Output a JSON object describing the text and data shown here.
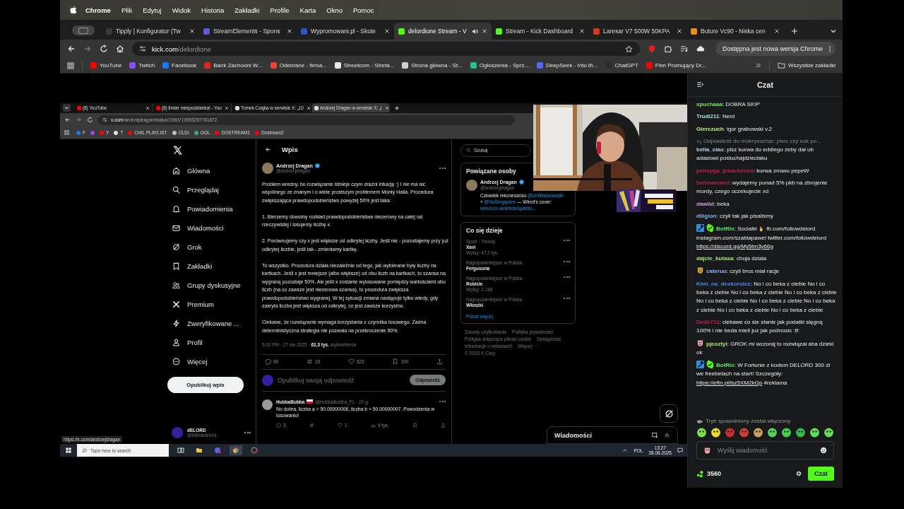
{
  "menu_bar": {
    "app": "Chrome",
    "items": [
      "Plik",
      "Edytuj",
      "Widok",
      "Historia",
      "Zakładki",
      "Profile",
      "Karta",
      "Okno",
      "Pomoc"
    ]
  },
  "tabs": [
    {
      "title": "Tipply | Konfigurator (Tw",
      "color": "#3a3a3a",
      "selected": false,
      "audio": false
    },
    {
      "title": "StreamElements - Spons",
      "color": "#5b5bd6",
      "selected": false,
      "audio": false
    },
    {
      "title": "Wypromowani.pl - Skute",
      "color": "#2f55c4",
      "selected": false,
      "audio": false
    },
    {
      "title": "delordione Stream - V",
      "color": "#53fc18",
      "selected": true,
      "audio": true
    },
    {
      "title": "Stream - Kick Dashboard",
      "color": "#53fc18",
      "selected": false,
      "audio": false
    },
    {
      "title": "Laresar V7 500W 50KPA",
      "color": "#d63a24",
      "selected": false,
      "audio": false
    },
    {
      "title": "Buture Vc90 - Niska cen",
      "color": "#f08c1a",
      "selected": false,
      "audio": false
    }
  ],
  "address": {
    "host": "kick.com",
    "path": "/delordione"
  },
  "update_button": "Dostępna jest nowa wersja Chrome",
  "bookmarks": [
    {
      "title": "YouTube",
      "color": "#ff0000"
    },
    {
      "title": "Twitch",
      "color": "#9146ff"
    },
    {
      "title": "Facebook",
      "color": "#1877f2"
    },
    {
      "title": "Bank Zachodni W...",
      "color": "#e0231b"
    },
    {
      "title": "Odebrane - firma...",
      "color": "#ea4335"
    },
    {
      "title": "Streetcom - Strefa...",
      "color": "#e8e8e8"
    },
    {
      "title": "Strona główna - St...",
      "color": "#cfcfcf"
    },
    {
      "title": "Ogłoszenia - Sprz...",
      "color": "#23c08a"
    },
    {
      "title": "DeepSeek - Into th...",
      "color": "#4d6bfe"
    },
    {
      "title": "ChatGPT",
      "color": "#2b2b2b"
    },
    {
      "title": "Film Promujący Dr...",
      "color": "#ff0000"
    }
  ],
  "all_bookmarks": "Wszystkie zakładki",
  "stream": {
    "tabs": [
      {
        "title": "(8) YouTube",
        "color": "#ff0000",
        "selected": false
      },
      {
        "title": "(8) tinder niespodzianka! - You",
        "color": "#ff0000",
        "selected": false
      },
      {
        "title": "Tomek Czajka w serwisie X: „10",
        "color": "#e0e0e0",
        "selected": false
      },
      {
        "title": "Andrzej Dragan w serwisie X: „I",
        "color": "#e0e0e0",
        "selected": true
      }
    ],
    "address": {
      "host": "x.com",
      "path": "/andrzejdragan/status/1960719555287781872"
    },
    "bookmarks": [
      {
        "title": "F",
        "color": "#1877f2"
      },
      {
        "color": "#9146ff"
      },
      {
        "title": "Y",
        "color": "#ff0000"
      },
      {
        "title": "T",
        "color": "#e0e0e0"
      },
      {
        "title": "CHIL PLAYLIST",
        "color": "#ff0000"
      },
      {
        "title": "OLD\\",
        "color": "#bbbbbb"
      },
      {
        "title": "GOL",
        "color": "#3aa88a"
      },
      {
        "title": "DOSTREAM1",
        "color": "#ff0000"
      },
      {
        "title": "Dostream2",
        "color": "#ff0000"
      }
    ],
    "nav": [
      {
        "label": "Główna",
        "kind": "home"
      },
      {
        "label": "Przeglądaj",
        "kind": "search"
      },
      {
        "label": "Powiadomienia",
        "kind": "bell"
      },
      {
        "label": "Wiadomości",
        "kind": "mail"
      },
      {
        "label": "Grok",
        "kind": "grok"
      },
      {
        "label": "Zakładki",
        "kind": "bookmark"
      },
      {
        "label": "Grupy dyskusyjne",
        "kind": "groups"
      },
      {
        "label": "Premium",
        "kind": "x"
      },
      {
        "label": "Zweryfikowane ...",
        "kind": "bolt"
      },
      {
        "label": "Profil",
        "kind": "person"
      },
      {
        "label": "Więcej",
        "kind": "more"
      }
    ],
    "post_button": "Opublikuj wpis",
    "account": {
      "name": "dELORD",
      "handle": "@followdelord"
    },
    "post": {
      "header": "Wpis",
      "author": "Andrzej Dragan",
      "handle": "@andrzejdragan",
      "paragraphs": [
        "Problem wredny, bo rozwiązanie istnieje czym drażni intuicję :) I nie ma nic wspólnego ze znanym i o wiele prostszym problemem Monty Halla. Procedura zwiększająca prawdopodobieństwo powyżej 50% jest taka:",
        "1. Bierzemy dowolny rozkład prawdopodobieństwa niezerowy na całej osi rzeczywistej i losujemy liczbę x.",
        "2. Porównujemy czy x jest większe od odkrytej liczby. Jeśli nie - pozostajemy przy już odkrytej liczbie, jeśli tak - zmieniamy kartkę.",
        "To wszystko. Procedura działa niezależnie od tego, jak wybierane były liczby na kartkach. Jeśli x jest mniejsze (albo większe) od obu liczb na kartkach, to szansa na wygraną pozostaje 50%. Ale jeśli x zostanie wylosowane pomiędzy wartościami obu liczb (na co zawsze jest niezerowa szansa), to procedura zwiększa prawdopodobieństwo wygranej. W tej sytuacji zmiana następuje tylko wtedy, gdy zakryta liczba jest większa od odkrytej, co jest zawsze korzystne.",
        "Ciekawe, że rozwiązanie wymaga korzystania z czynnika losowego. Żadna deterministyczna strategia nie pozwala na przekroczenie 50%."
      ],
      "meta": "5:02 PM · 27 sie 2025 · **62,3 tys.** wyświetlenia",
      "actions": [
        {
          "kind": "reply",
          "count": "89"
        },
        {
          "kind": "repost",
          "count": "15"
        },
        {
          "kind": "like",
          "count": "523"
        },
        {
          "kind": "bookmark",
          "count": "190"
        },
        {
          "kind": "share"
        }
      ]
    },
    "reply_placeholder": "Opublikuj swoją odpowiedź",
    "reply_button": "Odpowiedz",
    "reply": {
      "author": "HubbaBubba",
      "handle": "@HubbaBubba_PL · 20 g.",
      "text": "No dobra, liczba a = 50.00000006, liczba b = 50.00000007. Powodzenia w losowaniu!",
      "actions": [
        {
          "kind": "reply",
          "count": "3"
        },
        {
          "kind": "repost"
        },
        {
          "kind": "like",
          "count": "1"
        },
        {
          "kind": "views",
          "count": "9 tys."
        },
        {
          "kind": "bookmark"
        },
        {
          "kind": "share"
        }
      ]
    },
    "search_placeholder": "Szukaj",
    "related": {
      "title": "Powiązane osoby",
      "name": "Andrzej Dragan",
      "handle": "@andrzejdragan",
      "bio": [
        {
          "kind": "text",
          "text": "Człowiek rekonesansu"
        },
        {
          "kind": "mention",
          "text": "@UniWarszawski"
        },
        {
          "kind": "text",
          "text": "+"
        },
        {
          "kind": "mention",
          "text": "@NuSingapore"
        },
        {
          "kind": "text",
          "text": "— Wired's cover:"
        },
        {
          "kind": "link",
          "text": "wired.co.uk/article/quantu..."
        }
      ]
    },
    "trends": {
      "title": "Co się dzieje",
      "items": [
        {
          "context": "Sport · Trendy",
          "name": "Xavi",
          "count": "Wpisy: 47,2 tys."
        },
        {
          "context": "Najpopularniejsze w Polska",
          "name": "Fergusona"
        },
        {
          "context": "Najpopularniejsze w Polska",
          "name": "Robicie",
          "count": "Wpisy: 2 246"
        },
        {
          "context": "Najpopularniejsze w Polska",
          "name": "Włoszki"
        }
      ],
      "more": "Pokaż więcej"
    },
    "footer_links": [
      "Zasady użytkowania",
      "Polityka prywatności",
      "Polityka dotycząca plików cookie",
      "Dostępność",
      "Informacje o reklamach",
      "Więcej ···",
      "© 2025 X Corp."
    ],
    "messages_drawer": "Wiadomości",
    "status_url": "https://x.com/andrzejdragan",
    "taskbar": {
      "search_placeholder": "Type here to search",
      "language": "POL",
      "time": "13:27",
      "date": "28.08.2025"
    }
  },
  "chat": {
    "title": "Czat",
    "messages": [
      {
        "user": "spuchaaa",
        "color": "#7fe05c",
        "parts": [
          {
            "kind": "text",
            "text": ": DOBRA SKIP"
          }
        ]
      },
      {
        "user": "Trudi211",
        "color": "#a8e6de",
        "parts": [
          {
            "kind": "text",
            "text": ": Nerd"
          }
        ]
      },
      {
        "user": "Gierczuch",
        "color": "#bdf08a",
        "parts": [
          {
            "kind": "text",
            "text": ": igor grabowski v.2"
          }
        ]
      },
      {
        "reply_to": "Odpowiedź do mokrysuchar: piwo czy sok po...",
        "user": "bella_ciao",
        "color": "#b4d4f4",
        "parts": [
          {
            "kind": "text",
            "text": ": pisz kurwa do eddiego zeby dał ub adasiowi posluchajdzieciaku"
          }
        ]
      },
      {
        "user": "penepga_jebacbenzo",
        "color": "#c41e52",
        "parts": [
          {
            "kind": "text",
            "text": ": kurwa znowu pepeW"
          }
        ]
      },
      {
        "user": "benmarcwel",
        "color": "#c41e52",
        "parts": [
          {
            "kind": "text",
            "text": ": wydajemy ponad 5% pkb na zbrojenie mordy, czego oczekujecie xd"
          }
        ]
      },
      {
        "user": "dawiid",
        "color": "#d59ae6",
        "parts": [
          {
            "kind": "text",
            "text": ": beka"
          }
        ]
      },
      {
        "user": "diligion",
        "color": "#86ace6",
        "parts": [
          {
            "kind": "text",
            "text": ": czyli tak jak pisalismy"
          }
        ]
      },
      {
        "user": "BotRix",
        "color": "#5ee35e",
        "badges": [
          {
            "kind": "moderator"
          },
          {
            "kind": "verified"
          }
        ],
        "parts": [
          {
            "kind": "text",
            "text": ": Socialki"
          },
          {
            "kind": "hand"
          },
          {
            "kind": "text",
            "text": "fb.com/followdelord instagram.com/szablapawel twitter.com/followdelord"
          },
          {
            "kind": "link",
            "text": "https://discord.gg/My5tm3y66g"
          }
        ]
      },
      {
        "user": "dajcie_kutasa",
        "color": "#a6e472",
        "parts": [
          {
            "kind": "text",
            "text": ": chuja dziala"
          }
        ]
      },
      {
        "user": "cateruu",
        "color": "#94b4f4",
        "badges": [
          {
            "kind": "subscriber",
            "color": "#d8a838"
          }
        ],
        "parts": [
          {
            "kind": "text",
            "text": ": czyli brus miał racje"
          }
        ]
      },
      {
        "user": "Kiwi_na_deskorolce",
        "color": "#4a86e8",
        "parts": [
          {
            "kind": "text",
            "text": ": No i co beka z ciebie No i co beka z ciebie No i co beka z ciebie No i co beka z ciebie No i co beka z ciebie No i co beka z ciebie No i co beka z ciebie No i co beka z ciebie No i co beka z ciebie"
          }
        ]
      },
      {
        "user": "Dede711",
        "color": "#c41e52",
        "parts": [
          {
            "kind": "text",
            "text": ": ciekawe co sie stanie jak podatki sięgną 100% i nie beda mieli juz jak podnosic :tf:"
          }
        ]
      },
      {
        "user": "pjosztyl",
        "color": "#a6e472",
        "badges": [
          {
            "kind": "subscriber",
            "color": "#e6a0a8"
          }
        ],
        "parts": [
          {
            "kind": "text",
            "text": ": GROK mi wczoraj to rozwiązał aha dzieki ok"
          }
        ]
      },
      {
        "user": "BotRix",
        "color": "#5ee35e",
        "badges": [
          {
            "kind": "moderator"
          },
          {
            "kind": "verified"
          }
        ],
        "parts": [
          {
            "kind": "text",
            "text": ": W Fortunie z kodem DELORD 300 zł we freebetach na start! Szczegóły:"
          },
          {
            "kind": "link",
            "text": "https://eftn.pl/lsz5XM2kGp"
          },
          {
            "kind": "text",
            "text": "#reklama"
          }
        ]
      }
    ],
    "slow_mode": "Tryb spowolniony został włączony",
    "input_placeholder": "Wyślij wiadomość",
    "points": "3560",
    "send_button": "Czat"
  }
}
